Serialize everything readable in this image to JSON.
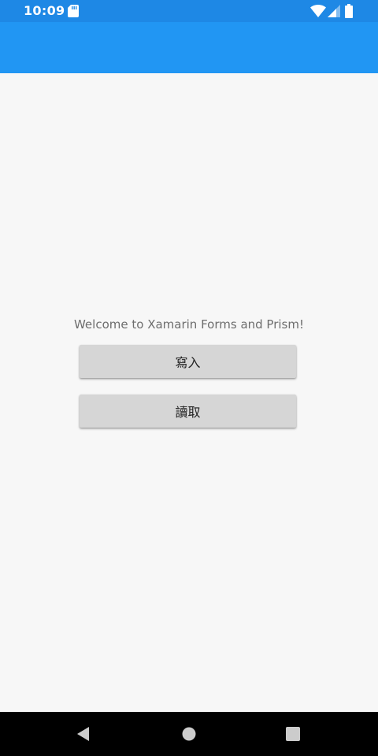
{
  "status_bar": {
    "time": "10:09",
    "icons": [
      "sd-card-icon",
      "wifi-icon",
      "signal-icon",
      "battery-icon"
    ]
  },
  "main": {
    "welcome_text": "Welcome to Xamarin Forms and Prism!",
    "buttons": [
      {
        "label": "寫入"
      },
      {
        "label": "讀取"
      }
    ]
  },
  "nav_bar": {
    "icons": [
      "back-icon",
      "home-icon",
      "recents-icon"
    ]
  },
  "colors": {
    "status_bar": "#1e88e5",
    "app_bar": "#2196f3",
    "background": "#f7f7f7",
    "button": "#d6d6d6",
    "nav_bar": "#000000"
  }
}
